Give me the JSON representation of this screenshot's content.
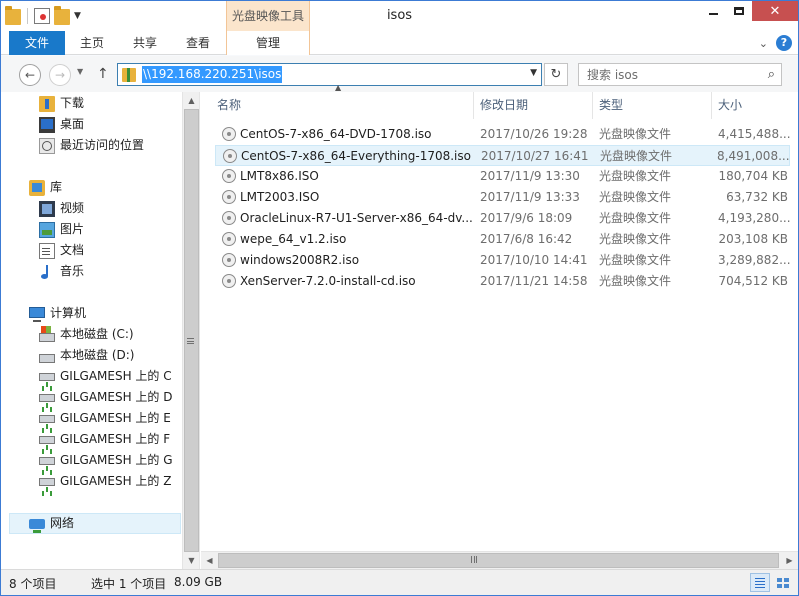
{
  "window": {
    "title": "isos",
    "context_tab_header": "光盘映像工具",
    "min_label": "",
    "max_label": "",
    "close_label": "✕"
  },
  "ribbon": {
    "tabs": [
      "文件",
      "主页",
      "共享",
      "查看",
      "管理"
    ],
    "help_label": "?"
  },
  "nav": {
    "back_glyph": "←",
    "forward_glyph": "→",
    "up_glyph": "↑",
    "address": "\\\\192.168.220.251\\isos",
    "refresh_glyph": "↻",
    "search_placeholder": "搜索 isos",
    "search_value": ""
  },
  "sidebar": {
    "favorites": [
      {
        "label": "下载",
        "icon": "downloads-folder-icon"
      },
      {
        "label": "桌面",
        "icon": "desktop-icon"
      },
      {
        "label": "最近访问的位置",
        "icon": "recent-places-icon"
      }
    ],
    "library": {
      "label": "库",
      "icon": "library-icon"
    },
    "library_items": [
      {
        "label": "视频",
        "icon": "video-icon"
      },
      {
        "label": "图片",
        "icon": "pictures-icon"
      },
      {
        "label": "文档",
        "icon": "documents-icon"
      },
      {
        "label": "音乐",
        "icon": "music-icon"
      }
    ],
    "computer": {
      "label": "计算机",
      "icon": "computer-icon"
    },
    "drives": [
      {
        "label": "本地磁盘 (C:)",
        "icon": "system-drive-icon"
      },
      {
        "label": "本地磁盘 (D:)",
        "icon": "local-drive-icon"
      },
      {
        "label": "GILGAMESH 上的 C",
        "icon": "network-drive-icon"
      },
      {
        "label": "GILGAMESH 上的 D",
        "icon": "network-drive-icon"
      },
      {
        "label": "GILGAMESH 上的 E",
        "icon": "network-drive-icon"
      },
      {
        "label": "GILGAMESH 上的 F",
        "icon": "network-drive-icon"
      },
      {
        "label": "GILGAMESH 上的 G",
        "icon": "network-drive-icon"
      },
      {
        "label": "GILGAMESH 上的 Z",
        "icon": "network-drive-icon"
      }
    ],
    "network": {
      "label": "网络",
      "icon": "network-icon"
    }
  },
  "filelist": {
    "columns": {
      "name": "名称",
      "date": "修改日期",
      "type": "类型",
      "size": "大小"
    },
    "files": [
      {
        "name": "CentOS-7-x86_64-DVD-1708.iso",
        "date": "2017/10/26 19:28",
        "type": "光盘映像文件",
        "size": "4,415,488...",
        "selected": false
      },
      {
        "name": "CentOS-7-x86_64-Everything-1708.iso",
        "date": "2017/10/27 16:41",
        "type": "光盘映像文件",
        "size": "8,491,008...",
        "selected": true
      },
      {
        "name": "LMT8x86.ISO",
        "date": "2017/11/9 13:30",
        "type": "光盘映像文件",
        "size": "180,704 KB",
        "selected": false
      },
      {
        "name": "LMT2003.ISO",
        "date": "2017/11/9 13:33",
        "type": "光盘映像文件",
        "size": "63,732 KB",
        "selected": false
      },
      {
        "name": "OracleLinux-R7-U1-Server-x86_64-dv...",
        "date": "2017/9/6 18:09",
        "type": "光盘映像文件",
        "size": "4,193,280...",
        "selected": false
      },
      {
        "name": "wepe_64_v1.2.iso",
        "date": "2017/6/8 16:42",
        "type": "光盘映像文件",
        "size": "203,108 KB",
        "selected": false
      },
      {
        "name": "windows2008R2.iso",
        "date": "2017/10/10 14:41",
        "type": "光盘映像文件",
        "size": "3,289,882...",
        "selected": false
      },
      {
        "name": "XenServer-7.2.0-install-cd.iso",
        "date": "2017/11/21 14:58",
        "type": "光盘映像文件",
        "size": "704,512 KB",
        "selected": false
      }
    ]
  },
  "status": {
    "item_count": "8 个项目",
    "selection": "选中 1 个项目",
    "selection_size": "8.09 GB"
  },
  "colors": {
    "accent": "#1979ca",
    "selection_bg": "#e5f3fb",
    "context_tab": "#fbe5cc",
    "close_button": "#c75050"
  }
}
